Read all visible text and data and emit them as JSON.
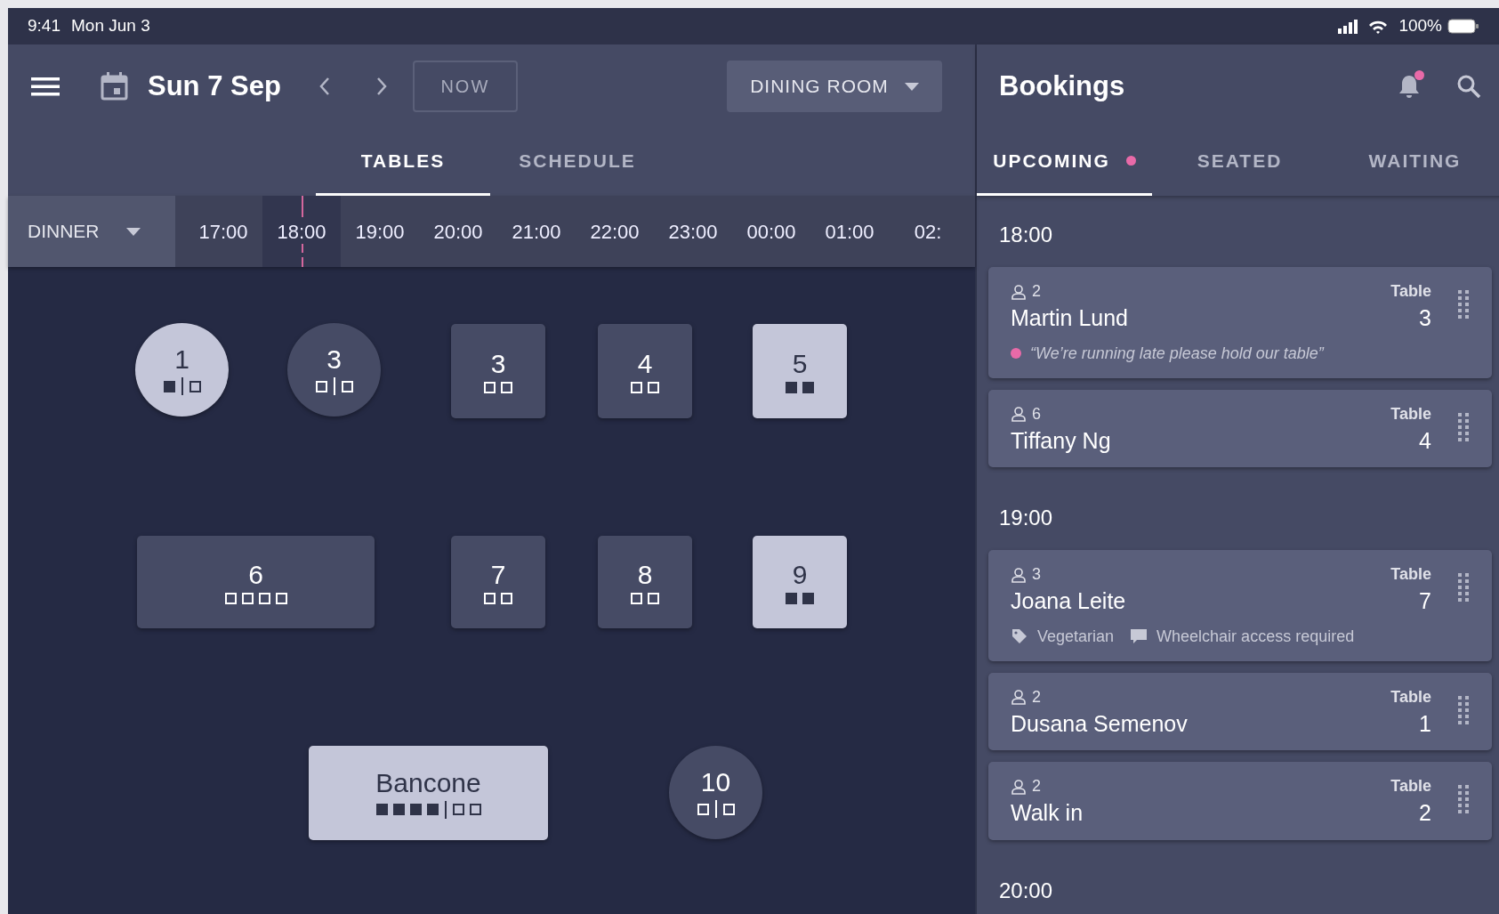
{
  "status_bar": {
    "time": "9:41",
    "date": "Mon Jun 3",
    "battery": "100%"
  },
  "header": {
    "date": "Sun 7 Sep",
    "now_button": "NOW",
    "room_selector": "DINING ROOM"
  },
  "view_tabs": [
    {
      "label": "TABLES",
      "selected": true
    },
    {
      "label": "SCHEDULE",
      "selected": false
    }
  ],
  "timeline": {
    "service": "DINNER",
    "slots": [
      {
        "label": "17:00",
        "selected": false
      },
      {
        "label": "18:00",
        "selected": true
      },
      {
        "label": "19:00",
        "selected": false
      },
      {
        "label": "20:00",
        "selected": false
      },
      {
        "label": "21:00",
        "selected": false
      },
      {
        "label": "22:00",
        "selected": false
      },
      {
        "label": "23:00",
        "selected": false
      },
      {
        "label": "00:00",
        "selected": false
      },
      {
        "label": "01:00",
        "selected": false
      },
      {
        "label": "02:",
        "selected": false
      }
    ]
  },
  "tables": [
    {
      "kind": "round",
      "number": "1",
      "occupied": true,
      "seat_groups": [
        [
          true
        ],
        [
          false
        ]
      ]
    },
    {
      "kind": "round",
      "number": "3",
      "occupied": false,
      "seat_groups": [
        [
          false
        ],
        [
          false
        ]
      ]
    },
    {
      "kind": "square",
      "number": "3",
      "occupied": false,
      "seat_groups": [
        [
          false,
          false
        ]
      ]
    },
    {
      "kind": "square",
      "number": "4",
      "occupied": false,
      "seat_groups": [
        [
          false,
          false
        ]
      ]
    },
    {
      "kind": "square",
      "number": "5",
      "occupied": true,
      "seat_groups": [
        [
          true,
          true
        ]
      ]
    },
    {
      "kind": "rect",
      "number": "6",
      "occupied": false,
      "seat_groups": [
        [
          false,
          false,
          false,
          false
        ]
      ]
    },
    {
      "kind": "square",
      "number": "7",
      "occupied": false,
      "seat_groups": [
        [
          false,
          false
        ]
      ]
    },
    {
      "kind": "square",
      "number": "8",
      "occupied": false,
      "seat_groups": [
        [
          false,
          false
        ]
      ]
    },
    {
      "kind": "square",
      "number": "9",
      "occupied": true,
      "seat_groups": [
        [
          true,
          true
        ]
      ]
    },
    {
      "kind": "rect",
      "number": "Bancone",
      "occupied": true,
      "seat_groups": [
        [
          true,
          true,
          true,
          true
        ],
        [
          false,
          false
        ]
      ]
    },
    {
      "kind": "round",
      "number": "10",
      "occupied": false,
      "seat_groups": [
        [
          false
        ],
        [
          false
        ]
      ]
    }
  ],
  "bookings": {
    "title": "Bookings",
    "notification": true,
    "tabs": [
      {
        "label": "UPCOMING",
        "selected": true,
        "dot": true
      },
      {
        "label": "SEATED",
        "selected": false,
        "dot": false
      },
      {
        "label": "WAITING",
        "selected": false,
        "dot": false
      }
    ],
    "sections": [
      {
        "time": "18:00",
        "items": [
          {
            "guests": "2",
            "name": "Martin Lund",
            "table_label": "Table",
            "table": "3",
            "details": [
              {
                "kind": "note",
                "text": "“We’re running late please hold our table”"
              }
            ]
          },
          {
            "guests": "6",
            "name": "Tiffany Ng",
            "table_label": "Table",
            "table": "4"
          }
        ]
      },
      {
        "time": "19:00",
        "items": [
          {
            "guests": "3",
            "name": "Joana Leite",
            "table_label": "Table",
            "table": "7",
            "details": [
              {
                "kind": "tag",
                "text": "Vegetarian"
              },
              {
                "kind": "comment",
                "text": "Wheelchair access required"
              }
            ]
          },
          {
            "guests": "2",
            "name": "Dusana Semenov",
            "table_label": "Table",
            "table": "1"
          },
          {
            "guests": "2",
            "name": "Walk in",
            "table_label": "Table",
            "table": "2"
          }
        ]
      },
      {
        "time": "20:00"
      }
    ]
  }
}
